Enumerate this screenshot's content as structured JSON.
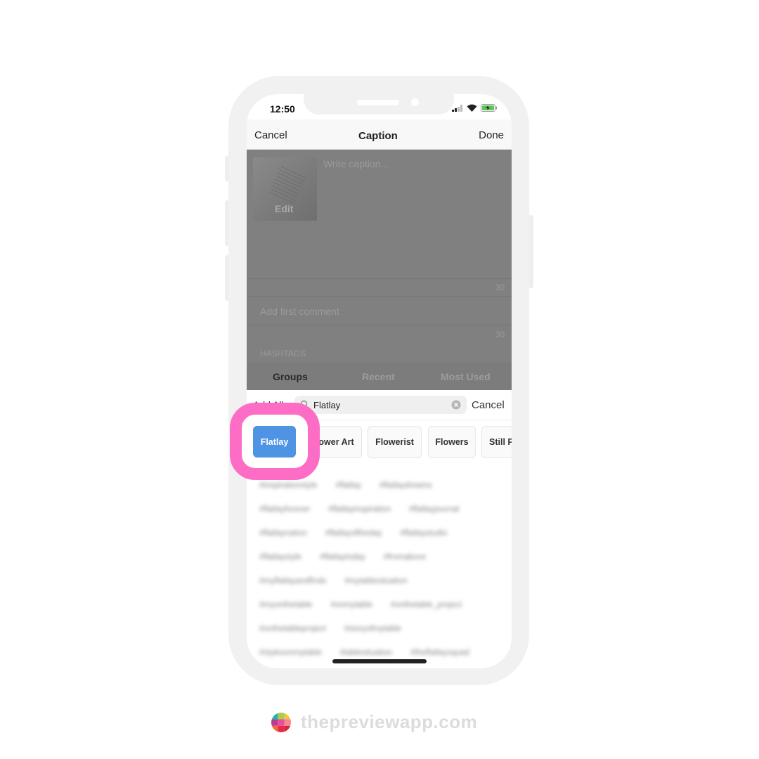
{
  "status_bar": {
    "time": "12:50"
  },
  "nav": {
    "cancel": "Cancel",
    "title": "Caption",
    "done": "Done"
  },
  "post": {
    "edit_label": "Edit",
    "caption_placeholder": "Write caption...",
    "caption_count": "30",
    "comment_placeholder": "Add first comment",
    "comment_count": "30",
    "hashtags_label": "HASHTAGS"
  },
  "tabs": [
    {
      "label": "Groups",
      "active": true
    },
    {
      "label": "Recent"
    },
    {
      "label": "Most Used"
    }
  ],
  "search": {
    "add_all": "Add All",
    "value": "Flatlay",
    "cancel": "Cancel"
  },
  "groups": [
    {
      "label": "Flatlay",
      "selected": true
    },
    {
      "label": "Flower Art"
    },
    {
      "label": "Flowerist"
    },
    {
      "label": "Flowers"
    },
    {
      "label": "Still Pi"
    }
  ],
  "hashtag_rows": [
    [
      "#inspirationstyle",
      "#flatlay",
      "#flatlaydreams"
    ],
    [
      "#flatlayforever",
      "#flatlayinspiration",
      "#flatlayjournal"
    ],
    [
      "#flatlaynation",
      "#flatlayoftheday",
      "#flatlaystudio"
    ],
    [
      "#flatlaystyle",
      "#flatlaytoday",
      "#fromabove"
    ],
    [
      "#myflatlayandfinds",
      "#mytablesituation"
    ],
    [
      "#myonthetable",
      "#onmytable",
      "#onthetable_project"
    ],
    [
      "#onthetableproject",
      "#storyofmytable"
    ],
    [
      "#stylesonmytable",
      "#tablesituation",
      "#theflatlaysquad"
    ]
  ],
  "brand": {
    "text": "thepreviewapp.com"
  },
  "colors": {
    "highlight": "#fd6dc6",
    "selected_chip": "#4f93e4",
    "overlay": "#808080"
  }
}
